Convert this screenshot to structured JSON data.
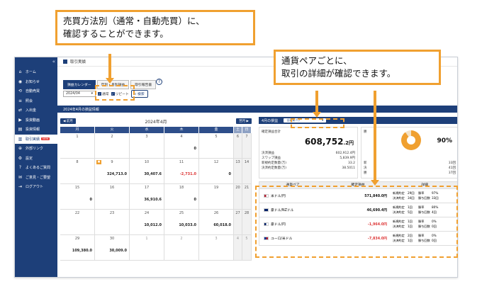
{
  "callouts": {
    "c1_line1": "売買方法別（通常・自動売買）に、",
    "c1_line2": "確認することができます。",
    "c2_line1": "通貨ペアごとに、",
    "c2_line2": "取引の詳細が確認できます。"
  },
  "sidebar": {
    "collapse": "«",
    "items": [
      {
        "label": "ホーム",
        "icon": "home-icon",
        "glyph": "⌂"
      },
      {
        "label": "お知らせ",
        "icon": "bell-icon",
        "glyph": "◉"
      },
      {
        "label": "自動売買",
        "icon": "robot-icon",
        "glyph": "⟲"
      },
      {
        "label": "照会",
        "icon": "list-icon",
        "glyph": "≡"
      },
      {
        "label": "入出金",
        "icon": "transfer-icon",
        "glyph": "⇄"
      },
      {
        "label": "投資動画",
        "icon": "video-icon",
        "glyph": "▶"
      },
      {
        "label": "投資情報",
        "icon": "info-icon",
        "glyph": "▤"
      },
      {
        "label": "取引実績",
        "icon": "chart-icon",
        "glyph": "▥",
        "badge": "NEW"
      },
      {
        "label": "外部リンク",
        "icon": "link-icon",
        "glyph": "⊕"
      },
      {
        "label": "設定",
        "icon": "gear-icon",
        "glyph": "⚙"
      },
      {
        "label": "よくあるご質問",
        "icon": "question-icon",
        "glyph": "?"
      },
      {
        "label": "ご意見・ご要望",
        "icon": "mail-icon",
        "glyph": "✉"
      },
      {
        "label": "ログアウト",
        "icon": "logout-icon",
        "glyph": "⇥"
      }
    ]
  },
  "header": {
    "breadcrumb": "取引実績"
  },
  "tabs": [
    "損益カレンダー",
    "年別・月別損益",
    "取引報告書"
  ],
  "filter": {
    "month": "2024/04",
    "check1": "通常",
    "check2": "リピート",
    "search": "検索"
  },
  "section_title": "2024年4月の損益情報",
  "calendar": {
    "prev": "◀ 前月",
    "title": "2024年4月",
    "next": "翌月 ▶",
    "dow": [
      "月",
      "火",
      "水",
      "木",
      "金",
      "土",
      "日"
    ],
    "weeks": [
      [
        {
          "d": "1",
          "v": ""
        },
        {
          "d": "2",
          "v": ""
        },
        {
          "d": "3",
          "v": ""
        },
        {
          "d": "4",
          "v": "0"
        },
        {
          "d": "5",
          "v": ""
        },
        {
          "d": "6",
          "v": "",
          "we": true
        },
        {
          "d": "7",
          "v": "",
          "we": true
        }
      ],
      [
        {
          "d": "8",
          "v": ""
        },
        {
          "d": "9",
          "v": "324,713.0",
          "tag": true
        },
        {
          "d": "10",
          "v": "30,407.6"
        },
        {
          "d": "11",
          "v": "-2,731.0",
          "neg": true
        },
        {
          "d": "12",
          "v": "0"
        },
        {
          "d": "13",
          "v": "",
          "we": true
        },
        {
          "d": "14",
          "v": "",
          "we": true
        }
      ],
      [
        {
          "d": "15",
          "v": "0"
        },
        {
          "d": "16",
          "v": ""
        },
        {
          "d": "17",
          "v": "36,910.6"
        },
        {
          "d": "18",
          "v": "0"
        },
        {
          "d": "19",
          "v": ""
        },
        {
          "d": "20",
          "v": "",
          "we": true
        },
        {
          "d": "21",
          "v": "",
          "we": true
        }
      ],
      [
        {
          "d": "22",
          "v": ""
        },
        {
          "d": "23",
          "v": ""
        },
        {
          "d": "24",
          "v": "10,012.0"
        },
        {
          "d": "25",
          "v": "10,033.0"
        },
        {
          "d": "26",
          "v": "60,018.0"
        },
        {
          "d": "27",
          "v": "",
          "we": true
        },
        {
          "d": "28",
          "v": "",
          "we": true
        }
      ],
      [
        {
          "d": "29",
          "v": "109,380.0"
        },
        {
          "d": "30",
          "v": "30,009.0"
        },
        {
          "d": "1",
          "v": "",
          "other": true
        },
        {
          "d": "2",
          "v": "",
          "other": true
        },
        {
          "d": "3",
          "v": "",
          "other": true
        },
        {
          "d": "4",
          "v": "",
          "we": true,
          "other": true
        },
        {
          "d": "5",
          "v": "",
          "we": true,
          "other": true
        }
      ]
    ]
  },
  "right": {
    "title": "4月の損益",
    "select": "全通貨ペア",
    "total_label": "確定損益合計",
    "total_value": "608,752",
    "total_dec": ".2",
    "total_unit": "円",
    "kv": [
      {
        "k": "決済損益",
        "v": "602,912.4円"
      },
      {
        "k": "スワップ損益",
        "v": "5,839.9円"
      },
      {
        "k": "新規約定数量(万)",
        "v": "33.2"
      },
      {
        "k": "決済約定数量(万)",
        "v": "38.5011"
      }
    ],
    "win_label": "勝",
    "win_pct": "90%",
    "win_rows": [
      {
        "k": "新",
        "v": "33回"
      },
      {
        "k": "決",
        "v": "41回"
      },
      {
        "k": "勝",
        "v": "37回"
      }
    ],
    "table_headers": [
      "通貨ペア",
      "確定損益",
      "詳細"
    ],
    "pairs": [
      {
        "name": "米ドル/円",
        "amt": "571,840.0円",
        "neg": false,
        "n1": "29回",
        "n2": "34回",
        "w": "97%",
        "wc": "33回",
        "flag": "us-jp"
      },
      {
        "name": "豪ドル/NZドル",
        "amt": "46,690.4円",
        "neg": false,
        "n1": "1回",
        "n2": "5回",
        "w": "80%",
        "wc": "4回",
        "flag": "au-nz"
      },
      {
        "name": "豪ドル/円",
        "amt": "-1,964.0円",
        "neg": true,
        "n1": "1回",
        "n2": "1回",
        "w": "0%",
        "wc": "0回",
        "flag": "au-jp"
      },
      {
        "name": "ユーロ/米ドル",
        "amt": "-7,834.0円",
        "neg": true,
        "n1": "2回",
        "n2": "1回",
        "w": "0%",
        "wc": "0回",
        "flag": "eu-us"
      }
    ],
    "det_labels": {
      "new": "新規約定",
      "close": "決済約定",
      "wr": "勝率",
      "wn": "勝ち回数"
    }
  },
  "colors": {
    "navy": "#1d3f79",
    "accent": "#f0a030",
    "neg": "#dd3333"
  }
}
